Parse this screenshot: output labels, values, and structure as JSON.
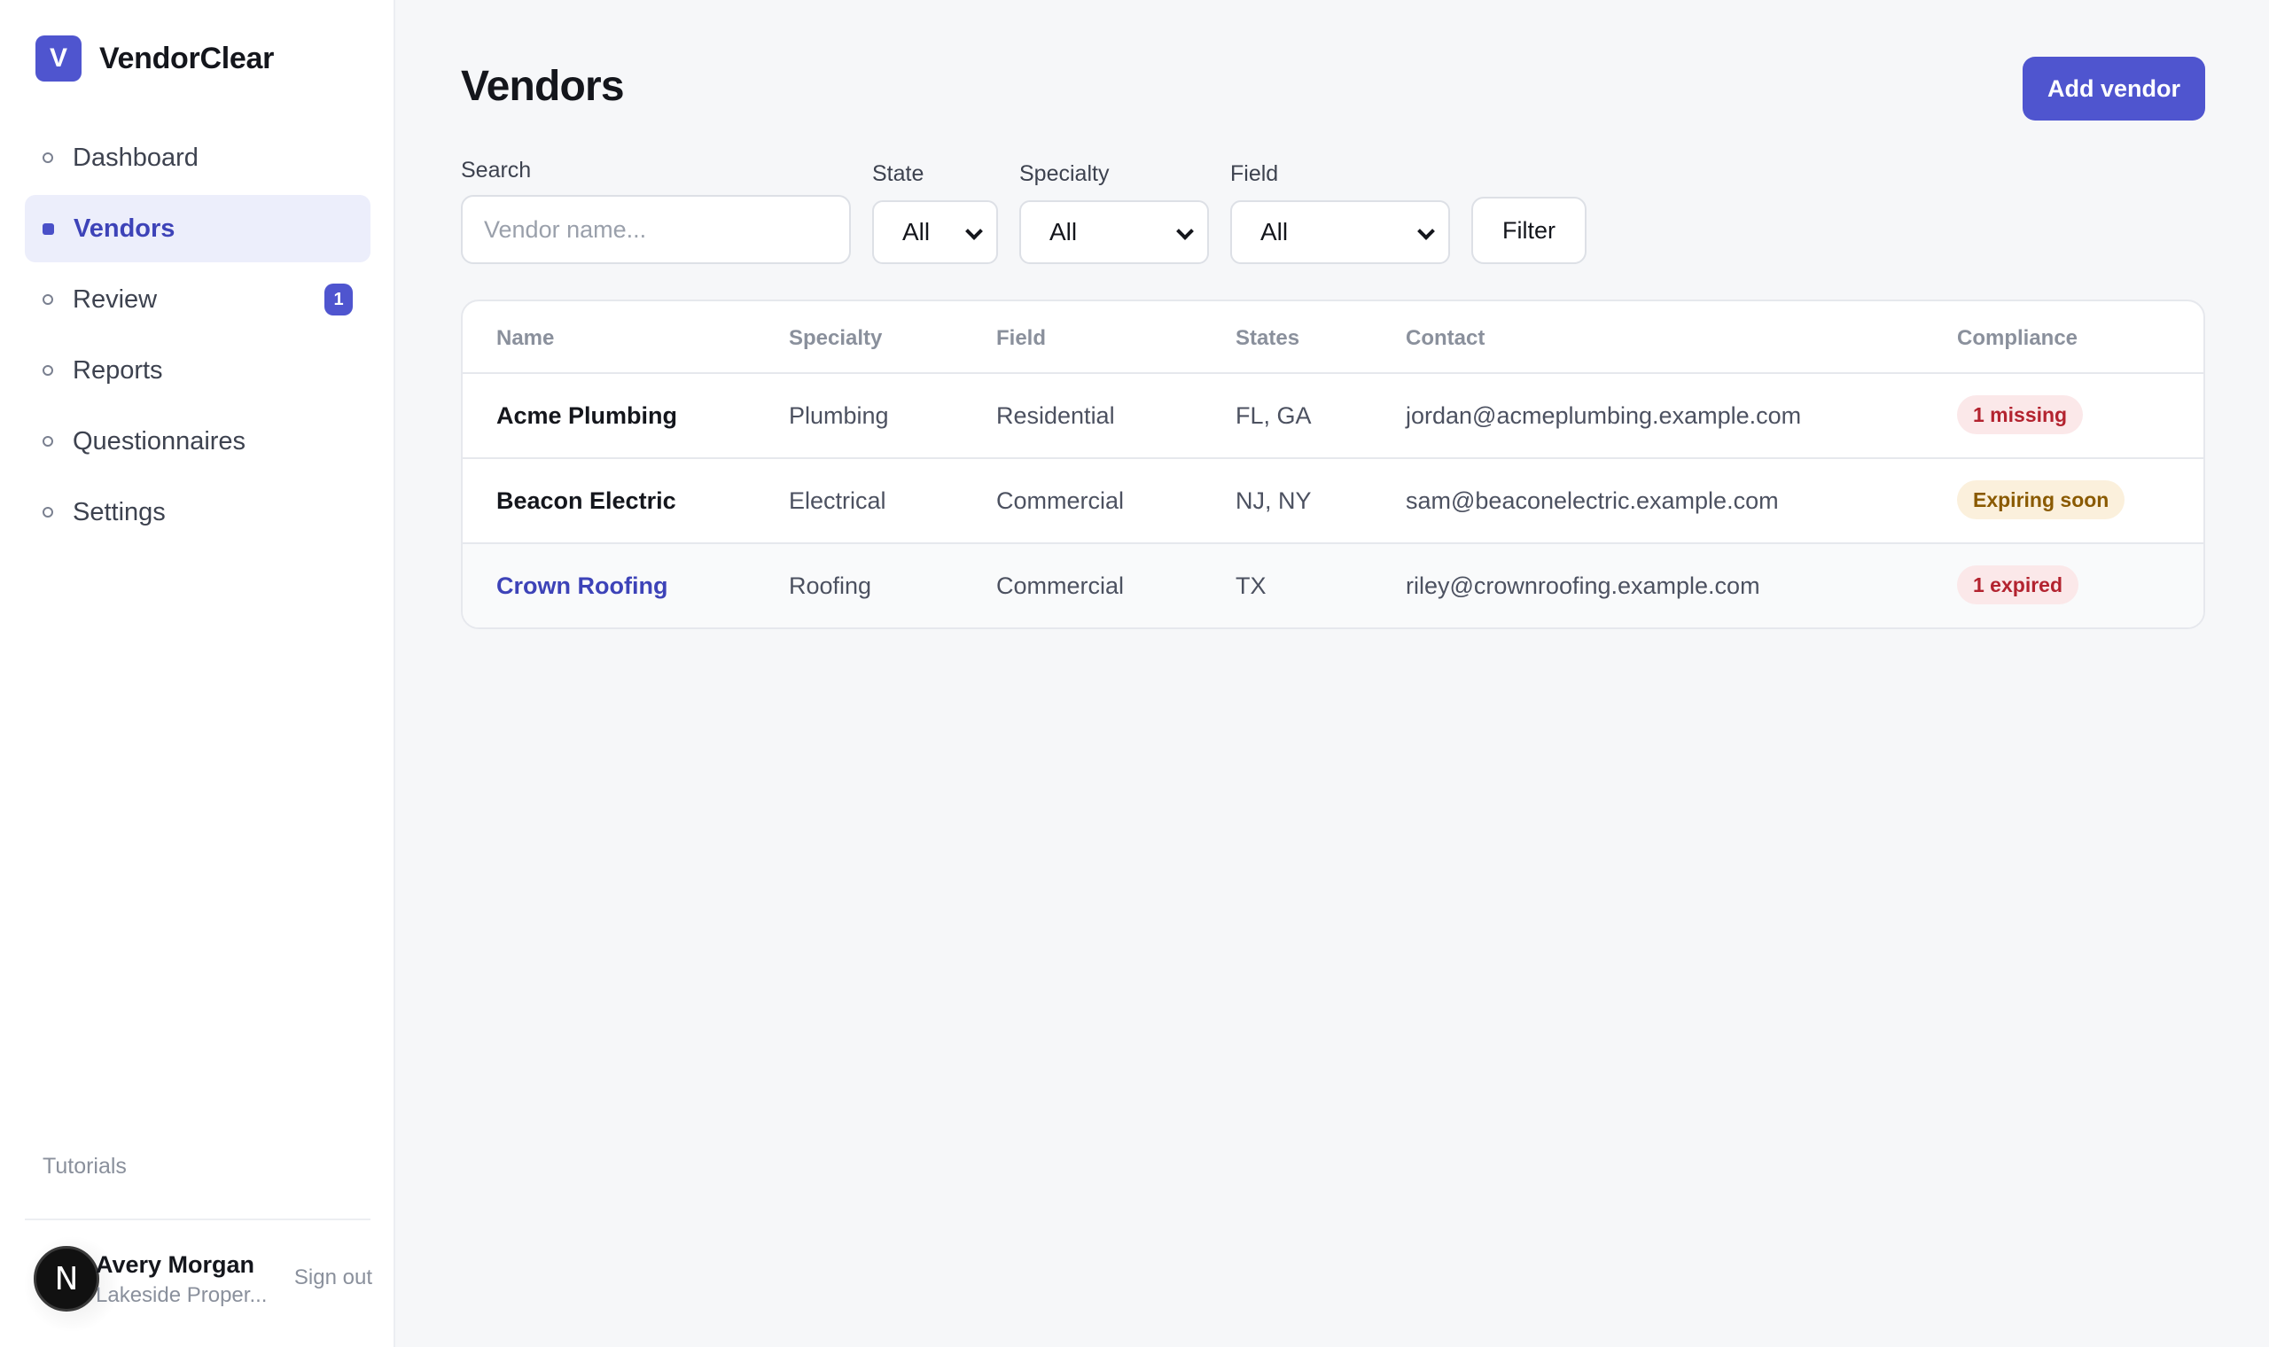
{
  "brand": {
    "logo_letter": "V",
    "name": "VendorClear",
    "accent": "#4f55cf"
  },
  "nav": {
    "items": [
      {
        "label": "Dashboard"
      },
      {
        "label": "Vendors",
        "active": true
      },
      {
        "label": "Review",
        "badge": "1"
      },
      {
        "label": "Reports"
      },
      {
        "label": "Questionnaires"
      },
      {
        "label": "Settings"
      }
    ]
  },
  "sidebar_footer": {
    "tutorials": "Tutorials",
    "user": {
      "initial": "N",
      "name": "Avery Morgan",
      "org": "Lakeside Proper..."
    },
    "sign_out": "Sign out"
  },
  "page": {
    "title": "Vendors",
    "add_button": "Add vendor"
  },
  "filters": {
    "search": {
      "label": "Search",
      "placeholder": "Vendor name..."
    },
    "state": {
      "label": "State",
      "value": "All"
    },
    "specialty": {
      "label": "Specialty",
      "value": "All"
    },
    "field": {
      "label": "Field",
      "value": "All"
    },
    "filter_button": "Filter"
  },
  "table": {
    "columns": [
      "Name",
      "Specialty",
      "Field",
      "States",
      "Contact",
      "Compliance"
    ],
    "rows": [
      {
        "name": "Acme Plumbing",
        "specialty": "Plumbing",
        "field": "Residential",
        "states": "FL, GA",
        "contact": "jordan@acmeplumbing.example.com",
        "compliance": "1 missing",
        "status": "red"
      },
      {
        "name": "Beacon Electric",
        "specialty": "Electrical",
        "field": "Commercial",
        "states": "NJ, NY",
        "contact": "sam@beaconelectric.example.com",
        "compliance": "Expiring soon",
        "status": "amber"
      },
      {
        "name": "Crown Roofing",
        "specialty": "Roofing",
        "field": "Commercial",
        "states": "TX",
        "contact": "riley@crownroofing.example.com",
        "compliance": "1 expired",
        "status": "red"
      }
    ]
  },
  "colors": {
    "danger": "#b3232f",
    "warning": "#8a5a00",
    "link": "#3d43b8"
  }
}
